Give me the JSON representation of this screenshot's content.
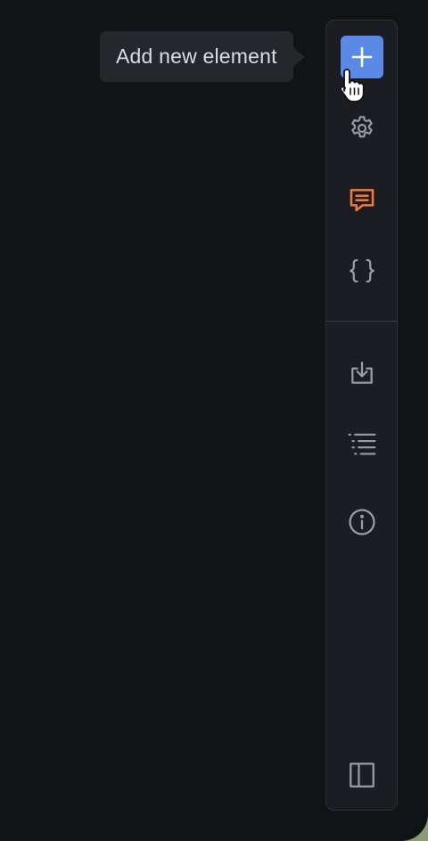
{
  "tooltip": {
    "text": "Add new element"
  },
  "toolbar": {
    "tools": [
      {
        "name": "add",
        "icon": "plus-icon",
        "color": "#ffffff",
        "background": "#5b8ae6",
        "state": "hovered"
      },
      {
        "name": "settings",
        "icon": "gear-icon",
        "color": "#9a9ca3"
      },
      {
        "name": "comments",
        "icon": "message-icon",
        "color": "#f07a3a",
        "state": "active"
      },
      {
        "name": "code",
        "icon": "curly-braces-icon",
        "color": "#9a9ca3"
      },
      {
        "name": "import",
        "icon": "download-tray-icon",
        "color": "#9a9ca3"
      },
      {
        "name": "outline",
        "icon": "list-icon",
        "color": "#9a9ca3"
      },
      {
        "name": "info",
        "icon": "info-circle-icon",
        "color": "#9a9ca3"
      },
      {
        "name": "toggle-panel",
        "icon": "sidebar-panel-icon",
        "color": "#9a9ca3"
      }
    ]
  },
  "colors": {
    "background": "#121317",
    "toolbar": "#1c1d22",
    "accent": "#5b8ae6",
    "active": "#f07a3a",
    "icon": "#9a9ca3"
  }
}
